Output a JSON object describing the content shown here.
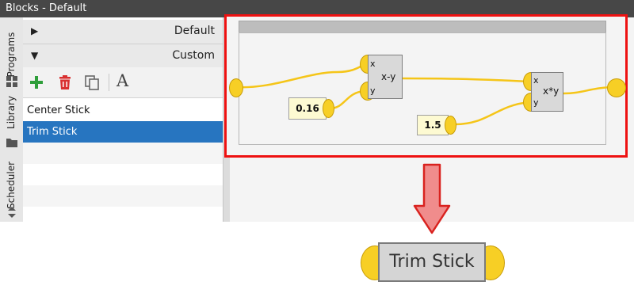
{
  "window": {
    "title": "Blocks - Default"
  },
  "side_tabs": {
    "programs": "Programs",
    "library": "Library",
    "scheduler": "Scheduler"
  },
  "library": {
    "groups": [
      {
        "expanded": false,
        "label": "Default",
        "arrow": "▶"
      },
      {
        "expanded": true,
        "label": "Custom",
        "arrow": "▼"
      }
    ],
    "toolbar": {
      "add_icon": "plus-icon",
      "delete_icon": "trash-icon",
      "copy_icon": "copy-icon",
      "rename_label": "A",
      "add_color": "#2e9e3a",
      "delete_color": "#d93030"
    },
    "items": [
      {
        "label": "Center Stick",
        "selected": false
      },
      {
        "label": "Trim Stick",
        "selected": true
      }
    ]
  },
  "diagram": {
    "constant_1": "0.16",
    "constant_2": "1.5",
    "subtract_block": {
      "in_x": "x",
      "in_y": "y",
      "op": "x-y"
    },
    "multiply_block": {
      "in_x": "x",
      "in_y": "y",
      "op": "x*y"
    },
    "highlight_color": "#ee1111",
    "wire_color": "#f5c518"
  },
  "custom_block": {
    "label": "Trim Stick"
  },
  "arrow": {
    "color": "#f08c8c",
    "direction": "down"
  }
}
